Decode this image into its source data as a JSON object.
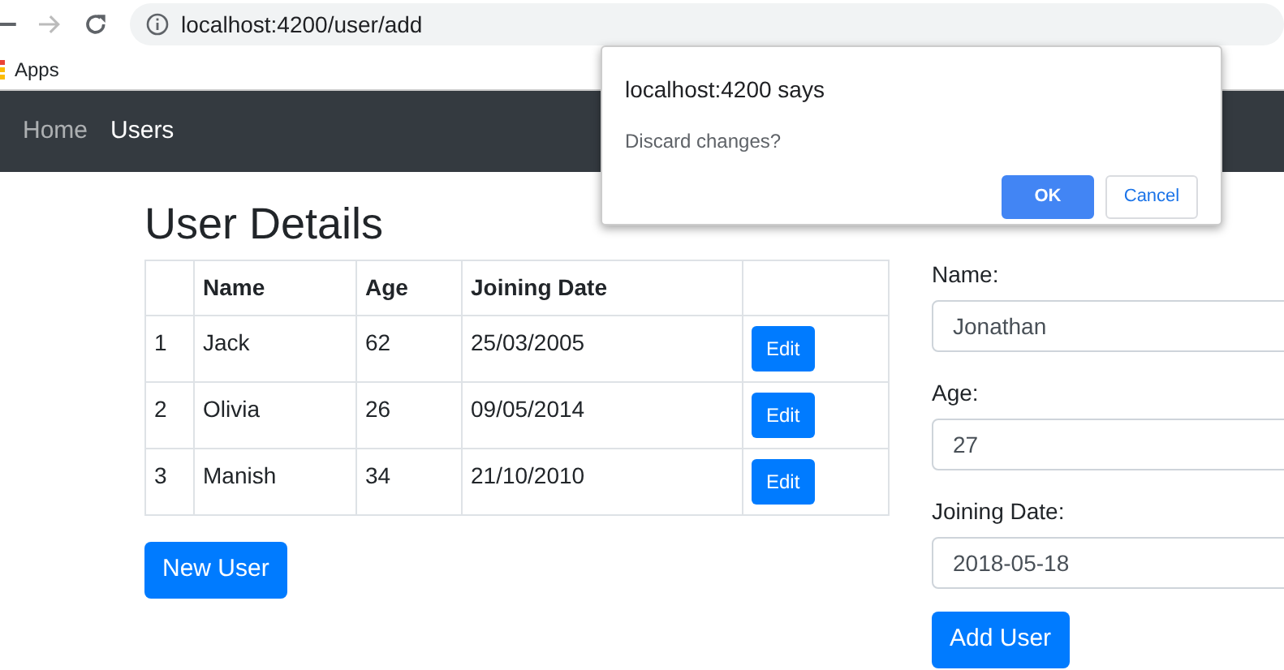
{
  "browser": {
    "url": "localhost:4200/user/add",
    "bookmarks": [
      "Apps"
    ]
  },
  "navbar": {
    "links": [
      {
        "label": "Home",
        "selected": false
      },
      {
        "label": "Users",
        "selected": true
      }
    ]
  },
  "user_details": {
    "title": "User Details",
    "columns": [
      "",
      "Name",
      "Age",
      "Joining Date",
      ""
    ],
    "rows": [
      {
        "index": "1",
        "name": "Jack",
        "age": "62",
        "joining_date": "25/03/2005",
        "action": "Edit"
      },
      {
        "index": "2",
        "name": "Olivia",
        "age": "26",
        "joining_date": "09/05/2014",
        "action": "Edit"
      },
      {
        "index": "3",
        "name": "Manish",
        "age": "34",
        "joining_date": "21/10/2010",
        "action": "Edit"
      }
    ],
    "new_button": "New User"
  },
  "add_user": {
    "fields": [
      {
        "label": "Name:",
        "value": "Jonathan"
      },
      {
        "label": "Age:",
        "value": "27"
      },
      {
        "label": "Joining Date:",
        "value": "2018-05-18"
      }
    ],
    "submit": "Add User"
  },
  "dialog": {
    "title": "localhost:4200 says",
    "message": "Discard changes?",
    "buttons": [
      {
        "label": "OK",
        "kind": "primary"
      },
      {
        "label": "Cancel",
        "kind": "secondary"
      }
    ]
  }
}
